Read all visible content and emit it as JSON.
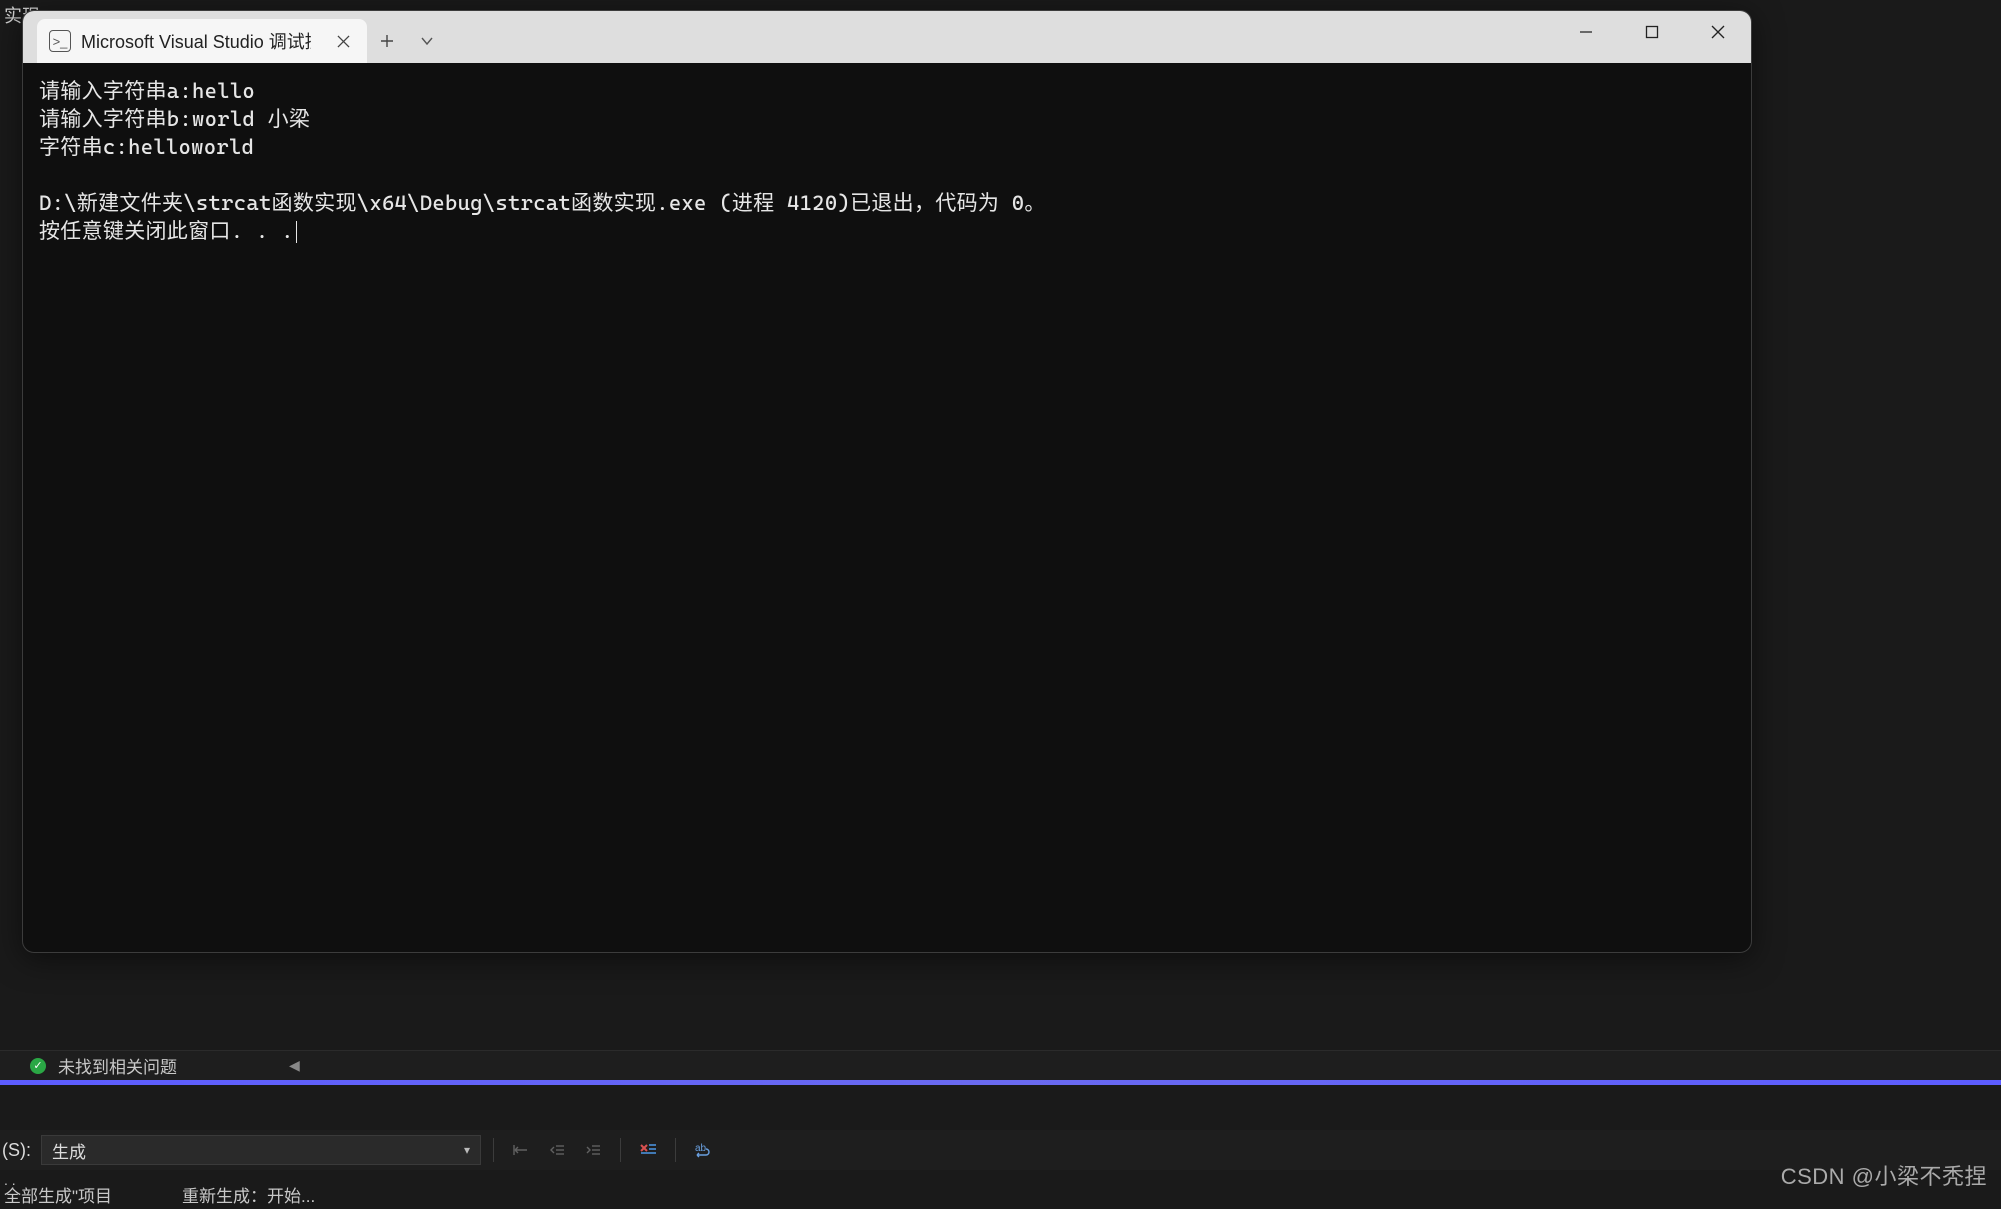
{
  "top_left_fragment": "实现",
  "tab": {
    "title": "Microsoft Visual Studio 调试控",
    "icon_glyph": ">_"
  },
  "terminal": {
    "lines": [
      "请输入字符串a:hello",
      "请输入字符串b:world 小梁",
      "字符串c:helloworld",
      "",
      "D:\\新建文件夹\\strcat函数实现\\x64\\Debug\\strcat函数实现.exe (进程 4120)已退出，代码为 0。",
      "按任意键关闭此窗口. . ."
    ]
  },
  "error_list": {
    "status_text": "未找到相关问题"
  },
  "output_toolbar": {
    "label": "(S):",
    "dropdown_value": "生成"
  },
  "bottom_fragment": {
    "left": "全部生成\"项目",
    "right": "重新生成：开始..."
  },
  "watermark": "CSDN @小梁不秃捏"
}
